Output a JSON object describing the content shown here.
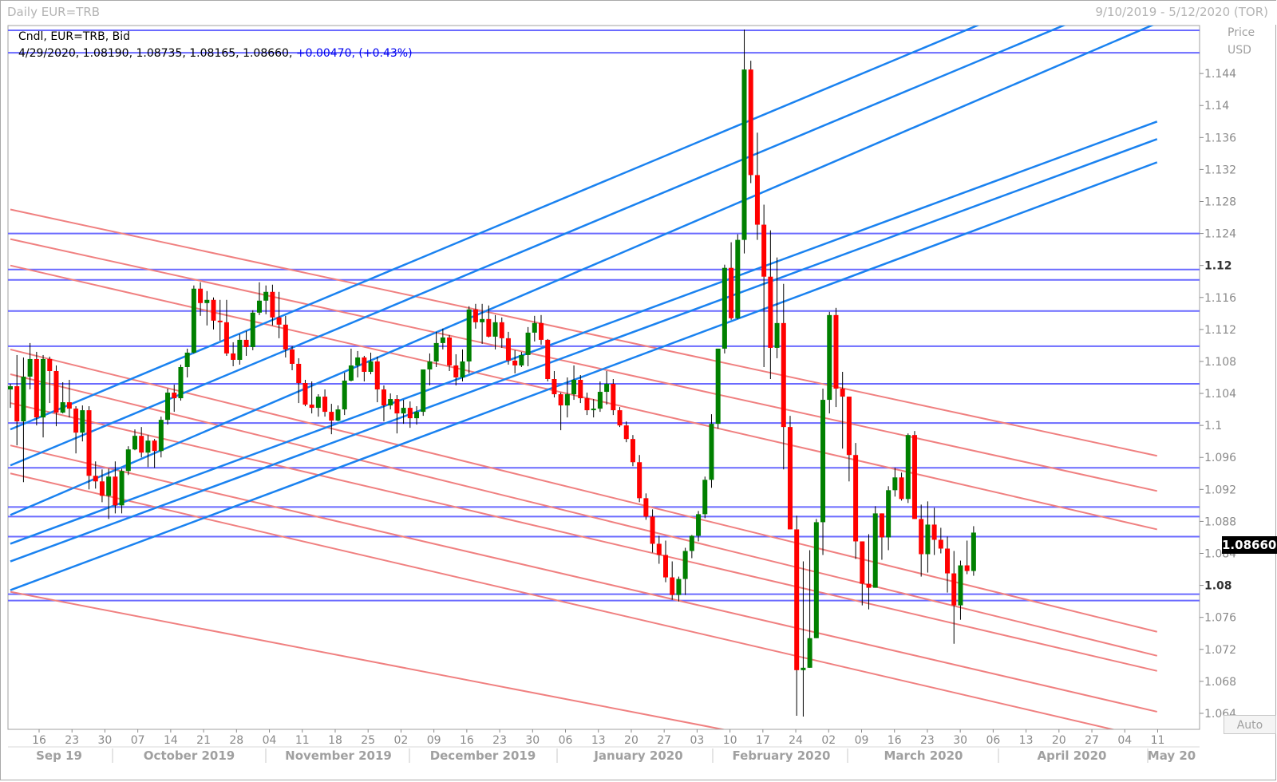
{
  "window": {
    "title": "Daily EUR=TRB",
    "date_range": "9/10/2019 - 5/12/2020 (TOR)"
  },
  "legend": {
    "line1": "Cndl, EUR=TRB, Bid",
    "ohlc": "4/29/2020, 1.08190, 1.08735, 1.08165, 1.08660, ",
    "change": "+0.00470, (+0.43%)"
  },
  "axis": {
    "price_label": "Price",
    "currency_label": "USD",
    "auto_label": "Auto",
    "last_price": "1.08660"
  },
  "colors": {
    "up": "#008000",
    "down": "#ff0000",
    "wick": "#000000",
    "horizontal_lines": "#6a6aff",
    "blue_channels": "#1a82f0",
    "red_channels": "#f08080",
    "grid": "#d3d3d3"
  },
  "chart_data": {
    "type": "candlestick",
    "instrument": "EUR=TRB",
    "ylim": [
      1.062,
      1.15
    ],
    "y_ticks": [
      {
        "value": 1.064,
        "label": "1.064"
      },
      {
        "value": 1.068,
        "label": "1.068"
      },
      {
        "value": 1.072,
        "label": "1.072"
      },
      {
        "value": 1.076,
        "label": "1.076"
      },
      {
        "value": 1.08,
        "label": "1.08",
        "bold": true
      },
      {
        "value": 1.084,
        "label": "1.084"
      },
      {
        "value": 1.088,
        "label": "1.088"
      },
      {
        "value": 1.092,
        "label": "1.092"
      },
      {
        "value": 1.096,
        "label": "1.096"
      },
      {
        "value": 1.1,
        "label": "1.1"
      },
      {
        "value": 1.104,
        "label": "1.104"
      },
      {
        "value": 1.108,
        "label": "1.108"
      },
      {
        "value": 1.112,
        "label": "1.112"
      },
      {
        "value": 1.116,
        "label": "1.116"
      },
      {
        "value": 1.12,
        "label": "1.12",
        "bold": true
      },
      {
        "value": 1.124,
        "label": "1.124"
      },
      {
        "value": 1.128,
        "label": "1.128"
      },
      {
        "value": 1.132,
        "label": "1.132"
      },
      {
        "value": 1.136,
        "label": "1.136"
      },
      {
        "value": 1.14,
        "label": "1.14"
      },
      {
        "value": 1.144,
        "label": "1.144"
      }
    ],
    "x_day_ticks": [
      "16",
      "23",
      "30",
      "07",
      "14",
      "21",
      "28",
      "04",
      "11",
      "18",
      "25",
      "02",
      "09",
      "16",
      "23",
      "30",
      "06",
      "13",
      "20",
      "27",
      "03",
      "10",
      "17",
      "24",
      "02",
      "09",
      "16",
      "23",
      "30",
      "06",
      "13",
      "20",
      "27",
      "04",
      "11"
    ],
    "x_month_ticks": [
      "Sep 19",
      "October 2019",
      "November 2019",
      "December 2019",
      "January 2020",
      "February 2020",
      "March 2020",
      "April 2020",
      "May 20"
    ],
    "candles": [
      [
        1.1045,
        1.1052,
        1.1022,
        1.1049
      ],
      [
        1.1049,
        1.1088,
        1.0975,
        1.1005
      ],
      [
        1.1005,
        1.1085,
        1.0929,
        1.1061
      ],
      [
        1.1061,
        1.1103,
        1.1045,
        1.1083
      ],
      [
        1.1083,
        1.1092,
        1.1,
        1.101
      ],
      [
        1.101,
        1.1088,
        1.0985,
        1.1083
      ],
      [
        1.1083,
        1.1086,
        1.1028,
        1.1068
      ],
      [
        1.1068,
        1.1075,
        1.0999,
        1.1016
      ],
      [
        1.1016,
        1.1054,
        1.1015,
        1.1029
      ],
      [
        1.1029,
        1.1057,
        1.101,
        1.1021
      ],
      [
        1.1021,
        1.1024,
        1.0965,
        1.0991
      ],
      [
        1.0991,
        1.1025,
        1.098,
        1.1019
      ],
      [
        1.1019,
        1.1024,
        1.092,
        1.0937
      ],
      [
        1.0937,
        1.0955,
        1.0921,
        1.093
      ],
      [
        1.093,
        1.0945,
        1.0904,
        1.0912
      ],
      [
        1.0912,
        1.0946,
        1.0883,
        1.0936
      ],
      [
        1.0936,
        1.0955,
        1.089,
        1.09
      ],
      [
        1.09,
        1.0946,
        1.089,
        1.0943
      ],
      [
        1.0943,
        1.0974,
        1.0938,
        1.097
      ],
      [
        1.097,
        1.0995,
        1.0969,
        1.0987
      ],
      [
        1.0987,
        1.0998,
        1.096,
        1.0966
      ],
      [
        1.0966,
        1.0988,
        1.0948,
        1.0981
      ],
      [
        1.0981,
        1.0983,
        1.0947,
        1.0968
      ],
      [
        1.0968,
        1.1011,
        1.096,
        1.1007
      ],
      [
        1.1007,
        1.1046,
        1.1001,
        1.1041
      ],
      [
        1.1041,
        1.1051,
        1.1017,
        1.1034
      ],
      [
        1.1034,
        1.1076,
        1.1031,
        1.1073
      ],
      [
        1.1073,
        1.1096,
        1.106,
        1.1091
      ],
      [
        1.1091,
        1.1175,
        1.109,
        1.1171
      ],
      [
        1.1171,
        1.1179,
        1.1137,
        1.1153
      ],
      [
        1.1153,
        1.1168,
        1.1125,
        1.1157
      ],
      [
        1.1157,
        1.116,
        1.112,
        1.1131
      ],
      [
        1.1131,
        1.1157,
        1.1106,
        1.1129
      ],
      [
        1.1129,
        1.1157,
        1.1087,
        1.109
      ],
      [
        1.109,
        1.1104,
        1.1074,
        1.1082
      ],
      [
        1.1082,
        1.1114,
        1.1076,
        1.1107
      ],
      [
        1.1107,
        1.1118,
        1.1087,
        1.1098
      ],
      [
        1.1098,
        1.1144,
        1.1094,
        1.1141
      ],
      [
        1.1141,
        1.1179,
        1.1138,
        1.1156
      ],
      [
        1.1156,
        1.1175,
        1.1139,
        1.1167
      ],
      [
        1.1167,
        1.1176,
        1.1125,
        1.1135
      ],
      [
        1.1135,
        1.1167,
        1.1109,
        1.1126
      ],
      [
        1.1126,
        1.1137,
        1.1085,
        1.1095
      ],
      [
        1.1095,
        1.1099,
        1.1069,
        1.1077
      ],
      [
        1.1077,
        1.1084,
        1.1028,
        1.1053
      ],
      [
        1.1053,
        1.1057,
        1.1024,
        1.1026
      ],
      [
        1.1026,
        1.1055,
        1.1015,
        1.1022
      ],
      [
        1.1022,
        1.1039,
        1.1011,
        1.1036
      ],
      [
        1.1036,
        1.1045,
        1.1011,
        1.1017
      ],
      [
        1.1017,
        1.1027,
        1.0989,
        1.1006
      ],
      [
        1.1006,
        1.1025,
        1.1005,
        1.102
      ],
      [
        1.102,
        1.1066,
        1.1013,
        1.1056
      ],
      [
        1.1056,
        1.1096,
        1.1055,
        1.1075
      ],
      [
        1.1075,
        1.1093,
        1.106,
        1.1085
      ],
      [
        1.1085,
        1.1087,
        1.1055,
        1.1067
      ],
      [
        1.1067,
        1.1091,
        1.1064,
        1.108
      ],
      [
        1.108,
        1.1086,
        1.1029,
        1.1045
      ],
      [
        1.1045,
        1.105,
        1.1005,
        1.1025
      ],
      [
        1.1025,
        1.104,
        1.102,
        1.1033
      ],
      [
        1.1033,
        1.1038,
        1.099,
        1.1015
      ],
      [
        1.1015,
        1.1032,
        1.1002,
        1.1022
      ],
      [
        1.1022,
        1.103,
        1.0997,
        1.1009
      ],
      [
        1.1009,
        1.1024,
        1.1001,
        1.1017
      ],
      [
        1.1017,
        1.1069,
        1.1012,
        1.107
      ],
      [
        1.107,
        1.109,
        1.105,
        1.108
      ],
      [
        1.108,
        1.1117,
        1.1073,
        1.1103
      ],
      [
        1.1103,
        1.1121,
        1.1095,
        1.111
      ],
      [
        1.111,
        1.1113,
        1.1068,
        1.1075
      ],
      [
        1.1075,
        1.1089,
        1.105,
        1.106
      ],
      [
        1.106,
        1.1095,
        1.1055,
        1.108
      ],
      [
        1.108,
        1.1149,
        1.1065,
        1.1145
      ],
      [
        1.1145,
        1.1152,
        1.1121,
        1.1129
      ],
      [
        1.1129,
        1.1152,
        1.1102,
        1.1133
      ],
      [
        1.1133,
        1.115,
        1.111,
        1.1111
      ],
      [
        1.1111,
        1.1138,
        1.1095,
        1.1129
      ],
      [
        1.1129,
        1.1135,
        1.1097,
        1.1109
      ],
      [
        1.1109,
        1.1117,
        1.1076,
        1.1081
      ],
      [
        1.1081,
        1.1094,
        1.1065,
        1.1075
      ],
      [
        1.1075,
        1.1092,
        1.1073,
        1.1088
      ],
      [
        1.1088,
        1.1123,
        1.1074,
        1.1116
      ],
      [
        1.1116,
        1.1137,
        1.1105,
        1.1128
      ],
      [
        1.1128,
        1.1138,
        1.1101,
        1.1107
      ],
      [
        1.1107,
        1.1108,
        1.1055,
        1.1058
      ],
      [
        1.1058,
        1.1068,
        1.1035,
        1.1039
      ],
      [
        1.1039,
        1.1041,
        1.0994,
        1.1025
      ],
      [
        1.1025,
        1.106,
        1.101,
        1.1039
      ],
      [
        1.1039,
        1.1075,
        1.1032,
        1.1057
      ],
      [
        1.1057,
        1.1063,
        1.1028,
        1.1034
      ],
      [
        1.1034,
        1.1041,
        1.1013,
        1.1019
      ],
      [
        1.1019,
        1.1033,
        1.101,
        1.1021
      ],
      [
        1.1021,
        1.1055,
        1.1017,
        1.1042
      ],
      [
        1.1042,
        1.1068,
        1.1026,
        1.1052
      ],
      [
        1.1052,
        1.1058,
        1.1013,
        1.1019
      ],
      [
        1.1019,
        1.1023,
        1.0998,
        1.1
      ],
      [
        1.1,
        1.1005,
        1.0979,
        1.0983
      ],
      [
        1.0983,
        1.0988,
        1.0949,
        1.0954
      ],
      [
        1.0954,
        1.0963,
        1.0904,
        1.0909
      ],
      [
        1.0909,
        1.0915,
        1.0882,
        1.0886
      ],
      [
        1.0886,
        1.0895,
        1.0841,
        1.0852
      ],
      [
        1.0852,
        1.0862,
        1.0827,
        1.0838
      ],
      [
        1.0838,
        1.0856,
        1.0804,
        1.081
      ],
      [
        1.081,
        1.083,
        1.0782,
        1.0788
      ],
      [
        1.0788,
        1.0811,
        1.078,
        1.0808
      ],
      [
        1.0808,
        1.0847,
        1.0788,
        1.0843
      ],
      [
        1.0843,
        1.0863,
        1.0834,
        1.0862
      ],
      [
        1.0862,
        1.0893,
        1.0855,
        1.0889
      ],
      [
        1.0889,
        1.0936,
        1.0884,
        1.0932
      ],
      [
        1.0932,
        1.1014,
        1.0922,
        1.1002
      ],
      [
        1.1002,
        1.1092,
        1.0996,
        1.1096
      ],
      [
        1.1096,
        1.1201,
        1.109,
        1.1197
      ],
      [
        1.1197,
        1.1229,
        1.1132,
        1.1134
      ],
      [
        1.1134,
        1.1239,
        1.1133,
        1.1232
      ],
      [
        1.1232,
        1.1495,
        1.1215,
        1.1445
      ],
      [
        1.1445,
        1.1456,
        1.1303,
        1.1313
      ],
      [
        1.1313,
        1.1366,
        1.1232,
        1.1251
      ],
      [
        1.1251,
        1.1276,
        1.1073,
        1.1186
      ],
      [
        1.1186,
        1.1244,
        1.1058,
        1.1097
      ],
      [
        1.1097,
        1.121,
        1.1084,
        1.1128
      ],
      [
        1.1128,
        1.1177,
        1.0945,
        1.0998
      ],
      [
        1.0998,
        1.1012,
        1.0878,
        1.087
      ],
      [
        1.087,
        1.0887,
        1.0637,
        1.0694
      ],
      [
        1.0694,
        1.083,
        1.0636,
        1.0697
      ],
      [
        1.0697,
        1.0844,
        1.0697,
        1.0734
      ],
      [
        1.0734,
        1.0883,
        1.0762,
        1.0879
      ],
      [
        1.0879,
        1.1046,
        1.0838,
        1.1032
      ],
      [
        1.1032,
        1.1142,
        1.1015,
        1.1138
      ],
      [
        1.1138,
        1.1147,
        1.1023,
        1.1046
      ],
      [
        1.1046,
        1.1067,
        1.0971,
        1.1036
      ],
      [
        1.1036,
        1.1015,
        1.093,
        1.0963
      ],
      [
        1.0963,
        1.0978,
        1.0833,
        1.0855
      ],
      [
        1.0855,
        1.0853,
        1.0775,
        1.0802
      ],
      [
        1.0802,
        1.0864,
        1.077,
        1.0797
      ],
      [
        1.0797,
        1.0899,
        1.0802,
        1.089
      ],
      [
        1.089,
        1.0886,
        1.0832,
        1.086
      ],
      [
        1.086,
        1.0924,
        1.0844,
        1.0919
      ],
      [
        1.0919,
        1.0947,
        1.0911,
        1.0935
      ],
      [
        1.0935,
        1.0941,
        1.0906,
        1.0908
      ],
      [
        1.0908,
        1.099,
        1.0903,
        1.0988
      ],
      [
        1.0988,
        1.0993,
        1.0895,
        1.0883
      ],
      [
        1.0883,
        1.0901,
        1.0811,
        1.0839
      ],
      [
        1.0839,
        1.0905,
        1.0816,
        1.0876
      ],
      [
        1.0876,
        1.0897,
        1.0838,
        1.0857
      ],
      [
        1.0857,
        1.0872,
        1.084,
        1.0846
      ],
      [
        1.0846,
        1.0861,
        1.0791,
        1.0815
      ],
      [
        1.0815,
        1.0843,
        1.0727,
        1.0775
      ],
      [
        1.0775,
        1.0831,
        1.0757,
        1.0825
      ],
      [
        1.0825,
        1.0856,
        1.0814,
        1.0818
      ],
      [
        1.0818,
        1.0874,
        1.0812,
        1.0866
      ]
    ],
    "horizontal_levels": [
      1.1494,
      1.1466,
      1.124,
      1.1195,
      1.1182,
      1.1143,
      1.1099,
      1.1052,
      1.1003,
      1.0947,
      1.0898,
      1.0886,
      1.0861,
      1.0789,
      1.0781
    ],
    "blue_trendlines": [
      [
        [
          0,
          1.0995
        ],
        [
          175,
          1.1594
        ]
      ],
      [
        [
          0,
          1.095
        ],
        [
          175,
          1.1549
        ]
      ],
      [
        [
          0,
          1.0888
        ],
        [
          175,
          1.1503
        ]
      ],
      [
        [
          0,
          1.0852
        ],
        [
          175,
          1.138
        ]
      ],
      [
        [
          0,
          1.083
        ],
        [
          175,
          1.1358
        ]
      ],
      [
        [
          0,
          1.0794
        ],
        [
          175,
          1.1329
        ]
      ]
    ],
    "red_trendlines": [
      [
        [
          0,
          1.127
        ],
        [
          175,
          1.0962
        ]
      ],
      [
        [
          0,
          1.1233
        ],
        [
          175,
          1.0918
        ]
      ],
      [
        [
          0,
          1.12
        ],
        [
          175,
          1.087
        ]
      ],
      [
        [
          0,
          1.1095
        ],
        [
          175,
          1.0742
        ]
      ],
      [
        [
          0,
          1.1064
        ],
        [
          175,
          1.0712
        ]
      ],
      [
        [
          0,
          1.1028
        ],
        [
          175,
          1.0693
        ]
      ],
      [
        [
          0,
          1.0975
        ],
        [
          175,
          1.0642
        ]
      ],
      [
        [
          0,
          1.094
        ],
        [
          175,
          1.0607
        ]
      ],
      [
        [
          0,
          1.0792
        ],
        [
          175,
          1.0515
        ]
      ]
    ]
  }
}
